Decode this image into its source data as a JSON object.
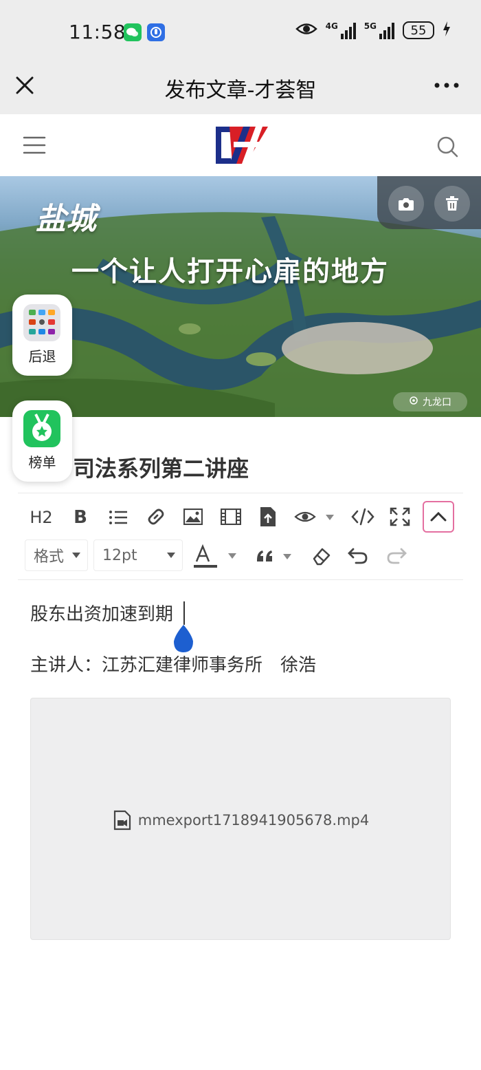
{
  "status_bar": {
    "time": "11:58",
    "network_1": "4G",
    "network_2": "5G",
    "battery": "55"
  },
  "header": {
    "title": "发布文章-才荟智"
  },
  "site_nav": {
    "logo_text": "CZH"
  },
  "banner": {
    "title_small": "盐城",
    "title": "一个让人打开心扉的地方",
    "tag": "九龙口"
  },
  "float_buttons": {
    "back_label": "后退",
    "ranking_label": "榜单"
  },
  "article": {
    "title": "司法系列第二讲座",
    "paragraph_1": "股东出资加速到期",
    "paragraph_2": "主讲人：江苏汇建律师事务所　徐浩",
    "video_filename": "mmexport1718941905678.mp4"
  },
  "toolbar": {
    "heading_label": "H2",
    "bold_label": "B",
    "format_label": "格式",
    "font_size": "12pt"
  },
  "colors": {
    "header_bg": "#ededed",
    "toggle_border": "#e46fa0",
    "cursor_handle": "#1d5fd0",
    "logo_blue": "#1c2f8a",
    "logo_red": "#d81f26"
  }
}
